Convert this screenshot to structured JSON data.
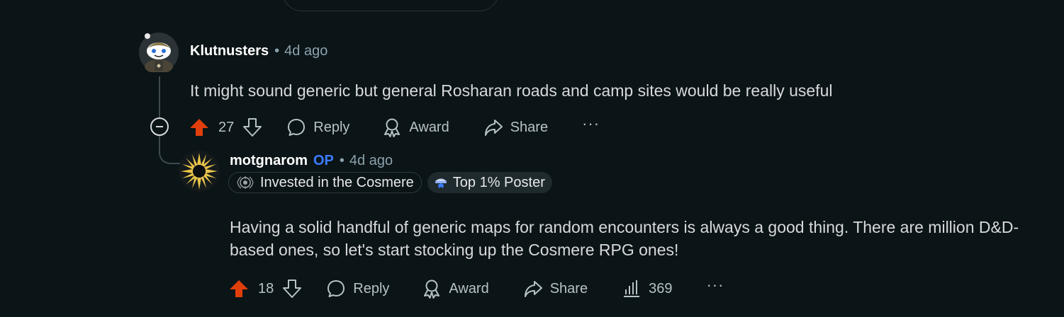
{
  "comments": [
    {
      "author": "Klutnusters",
      "separator": "•",
      "time": "4d ago",
      "body": "It might sound generic but general Rosharan roads and camp sites would be really useful",
      "score": "27",
      "actions": {
        "reply": "Reply",
        "award": "Award",
        "share": "Share",
        "more": "···"
      }
    },
    {
      "author": "motgnarom",
      "op_badge": "OP",
      "separator": "•",
      "time": "4d ago",
      "flairs": [
        {
          "icon": "cosmere-emblem-icon",
          "label": "Invested in the Cosmere"
        },
        {
          "icon": "top-poster-icon",
          "label": "Top 1% Poster"
        }
      ],
      "body": "Having a solid handful of generic maps for random encounters is always a good thing. There are million D&D-based ones, so let's start stocking up the Cosmere RPG ones!",
      "score": "18",
      "views": "369",
      "actions": {
        "reply": "Reply",
        "award": "Award",
        "share": "Share",
        "more": "···"
      }
    }
  ],
  "colors": {
    "background": "#0b1416",
    "upvote_active": "#e03f0b",
    "op_blue": "#3c7bff",
    "muted": "#8ba2ad"
  }
}
